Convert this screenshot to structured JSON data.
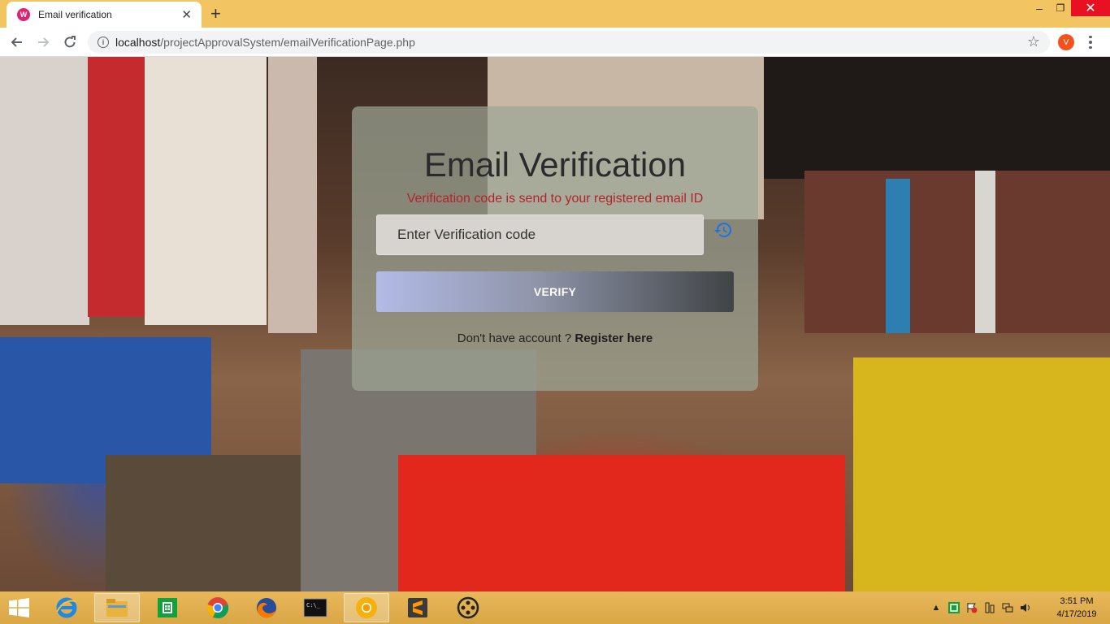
{
  "browser": {
    "tab_title": "Email verification",
    "tab_favicon_letter": "W",
    "tab_close": "✕",
    "new_tab": "+",
    "url_host": "localhost",
    "url_path": "/projectApprovalSystem/emailVerificationPage.php",
    "profile_initial": "V",
    "window_controls": {
      "minimize": "–",
      "maximize": "❐",
      "close": "✕"
    }
  },
  "page": {
    "title": "Email Verification",
    "message": "Verification code is send to your registered email ID",
    "code_placeholder": "Enter Verification code",
    "verify_label": "VERIFY",
    "register_prompt": "Don't have account ? ",
    "register_link": "Register here",
    "colors": {
      "message": "#b3242a",
      "card": "rgba(155,165,150,0.72)",
      "resend_icon": "#1a73e8"
    }
  },
  "taskbar": {
    "apps": [
      "internet-explorer-icon",
      "file-explorer-icon",
      "store-icon",
      "chrome-icon",
      "firefox-icon",
      "cmd-icon",
      "chrome-canary-icon",
      "sublime-text-icon",
      "media-icon"
    ],
    "clock_time": "3:51 PM",
    "clock_date": "4/17/2019"
  }
}
